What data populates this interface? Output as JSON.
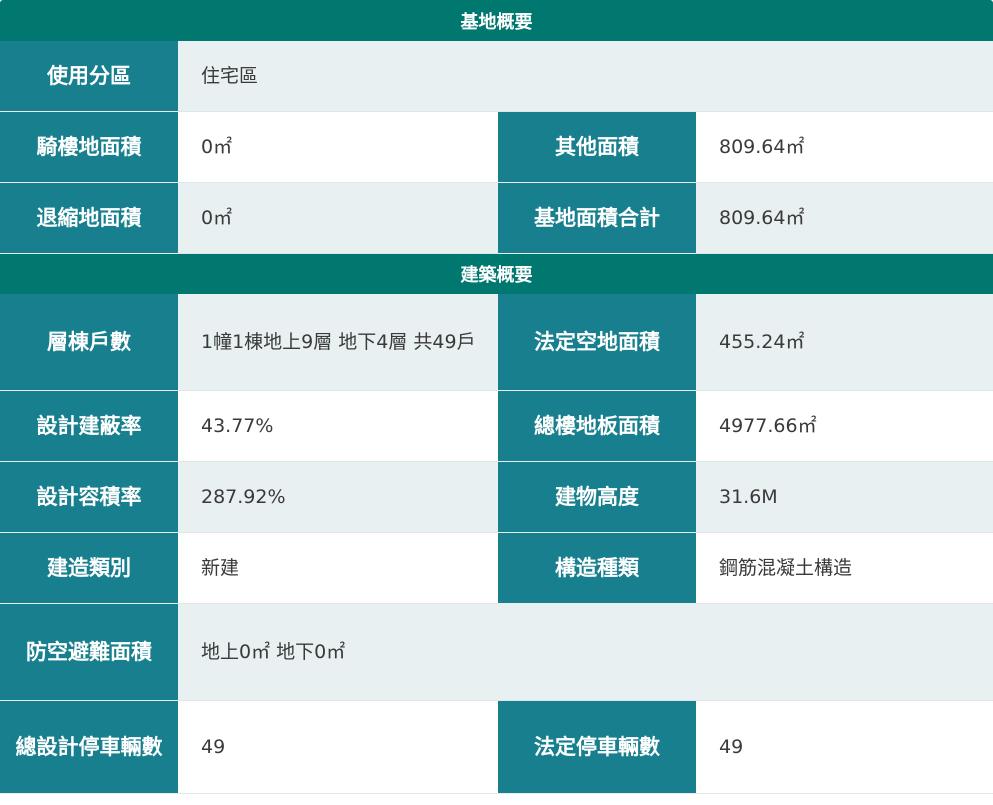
{
  "site_section": {
    "title": "基地概要",
    "zoning_label": "使用分區",
    "zoning_value": "住宅區",
    "arcade_area_label": "騎樓地面積",
    "arcade_area_value": "0㎡",
    "other_area_label": "其他面積",
    "other_area_value": "809.64㎡",
    "setback_area_label": "退縮地面積",
    "setback_area_value": "0㎡",
    "total_site_area_label": "基地面積合計",
    "total_site_area_value": "809.64㎡"
  },
  "building_section": {
    "title": "建築概要",
    "floors_units_label": "層棟戶數",
    "floors_units_value": "1幢1棟地上9層 地下4層 共49戶",
    "open_space_label": "法定空地面積",
    "open_space_value": "455.24㎡",
    "coverage_ratio_label": "設計建蔽率",
    "coverage_ratio_value": "43.77%",
    "total_floor_area_label": "總樓地板面積",
    "total_floor_area_value": "4977.66㎡",
    "far_label": "設計容積率",
    "far_value": "287.92%",
    "height_label": "建物高度",
    "height_value": "31.6M",
    "construction_type_label": "建造類別",
    "construction_type_value": "新建",
    "structure_type_label": "構造種類",
    "structure_type_value": "鋼筋混凝土構造",
    "shelter_area_label": "防空避難面積",
    "shelter_area_value": "地上0㎡ 地下0㎡",
    "design_parking_label": "總設計停車輛數",
    "design_parking_value": "49",
    "legal_parking_label": "法定停車輛數",
    "legal_parking_value": "49"
  }
}
